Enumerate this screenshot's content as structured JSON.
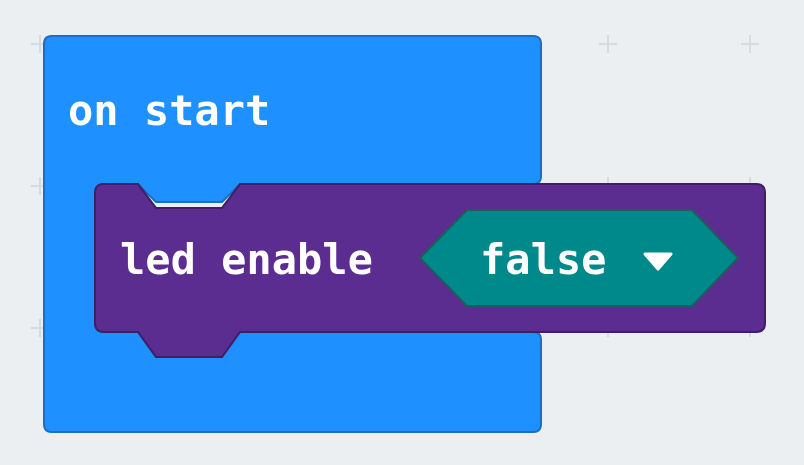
{
  "workspace": {
    "background_color": "#eceff1",
    "grid_mark_color": "#d6dbdf"
  },
  "hat_block": {
    "label": "on start",
    "color": "#1e90ff",
    "border_color": "#1a6fc4"
  },
  "statement_block": {
    "label": "led enable",
    "color": "#5c2d91",
    "border_color": "#3f1e66"
  },
  "dropdown": {
    "value": "false",
    "color": "#00898a",
    "border_color": "#1f5c5c",
    "arrow_icon": "caret-down-icon"
  }
}
